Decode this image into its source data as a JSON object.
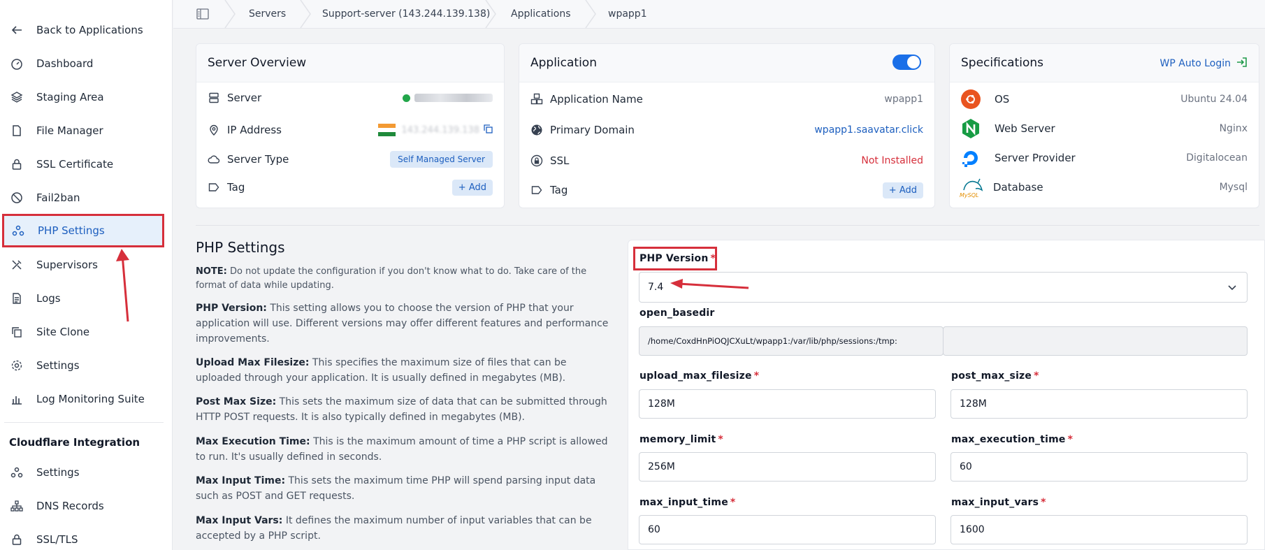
{
  "sidebar": {
    "items": [
      {
        "label": "Back to Applications",
        "icon": "arrow-left-icon"
      },
      {
        "label": "Dashboard",
        "icon": "gauge-icon"
      },
      {
        "label": "Staging Area",
        "icon": "layers-icon"
      },
      {
        "label": "File Manager",
        "icon": "file-icon"
      },
      {
        "label": "SSL Certificate",
        "icon": "lock-icon"
      },
      {
        "label": "Fail2ban",
        "icon": "ban-icon"
      },
      {
        "label": "PHP Settings",
        "icon": "nodes-icon"
      },
      {
        "label": "Supervisors",
        "icon": "tools-icon"
      },
      {
        "label": "Logs",
        "icon": "document-icon"
      },
      {
        "label": "Site Clone",
        "icon": "copy-icon"
      },
      {
        "label": "Settings",
        "icon": "gear-icon"
      },
      {
        "label": "Log Monitoring Suite",
        "icon": "chart-icon"
      }
    ],
    "cloudflare_heading": "Cloudflare Integration",
    "cloudflare_items": [
      {
        "label": "Settings",
        "icon": "nodes-icon"
      },
      {
        "label": "DNS Records",
        "icon": "sitemap-icon"
      },
      {
        "label": "SSL/TLS",
        "icon": "lock-icon"
      }
    ]
  },
  "breadcrumb": [
    "Servers",
    "Support-server (143.244.139.138)",
    "Applications",
    "wpapp1"
  ],
  "server_overview": {
    "title": "Server Overview",
    "server_label": "Server",
    "ip_label": "IP Address",
    "ip_value": "143.244.139.138",
    "type_label": "Server Type",
    "type_value": "Self Managed Server",
    "tag_label": "Tag",
    "add_label": "+ Add"
  },
  "application": {
    "title": "Application",
    "name_label": "Application Name",
    "name_value": "wpapp1",
    "domain_label": "Primary Domain",
    "domain_value": "wpapp1.saavatar.click",
    "ssl_label": "SSL",
    "ssl_value": "Not Installed",
    "tag_label": "Tag",
    "add_label": "+ Add",
    "toggle_on": true
  },
  "specifications": {
    "title": "Specifications",
    "wp_login": "WP Auto Login",
    "os_label": "OS",
    "os_value": "Ubuntu 24.04",
    "web_label": "Web Server",
    "web_value": "Nginx",
    "provider_label": "Server Provider",
    "provider_value": "Digitalocean",
    "db_label": "Database",
    "db_value": "Mysql",
    "db_logo_text": "MySQL"
  },
  "php_settings": {
    "title": "PHP Settings",
    "note_head": "NOTE:",
    "note_body": "Do not update the configuration if you don't know what to do. Take care of the format of data while updating.",
    "items": [
      {
        "head": "PHP Version:",
        "body": "This setting allows you to choose the version of PHP that your application will use. Different versions may offer different features and performance improvements."
      },
      {
        "head": "Upload Max Filesize:",
        "body": "This specifies the maximum size of files that can be uploaded through your application. It is usually defined in megabytes (MB)."
      },
      {
        "head": "Post Max Size:",
        "body": "This sets the maximum size of data that can be submitted through HTTP POST requests. It is also typically defined in megabytes (MB)."
      },
      {
        "head": "Max Execution Time:",
        "body": "This is the maximum amount of time a PHP script is allowed to run. It's usually defined in seconds."
      },
      {
        "head": "Max Input Time:",
        "body": "This sets the maximum time PHP will spend parsing input data such as POST and GET requests."
      },
      {
        "head": "Max Input Vars:",
        "body": "It defines the maximum number of input variables that can be accepted by a PHP script."
      }
    ]
  },
  "form": {
    "php_version_label": "PHP Version",
    "php_version_value": "7.4",
    "open_basedir_label": "open_basedir",
    "open_basedir_value": "/home/CoxdHnPiOQJCXuLt/wpapp1:/var/lib/php/sessions:/tmp:",
    "upload_label": "upload_max_filesize",
    "upload_value": "128M",
    "post_label": "post_max_size",
    "post_value": "128M",
    "memory_label": "memory_limit",
    "memory_value": "256M",
    "exec_label": "max_execution_time",
    "exec_value": "60",
    "input_time_label": "max_input_time",
    "input_time_value": "60",
    "input_vars_label": "max_input_vars",
    "input_vars_value": "1600"
  },
  "colors": {
    "accent": "#1d5fbf",
    "highlight": "#d62f3b"
  }
}
